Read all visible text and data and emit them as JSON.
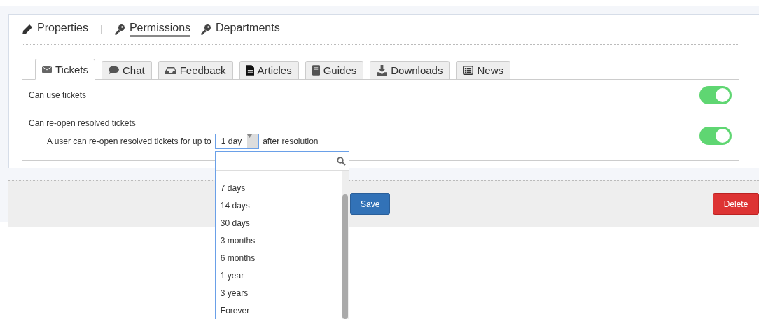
{
  "nav": [
    {
      "kind": "pencil",
      "label": "Properties",
      "selected": false
    },
    {
      "kind": "key",
      "label": "Permissions",
      "selected": true
    },
    {
      "kind": "key",
      "label": "Departments",
      "selected": false
    }
  ],
  "tabs": [
    {
      "kind": "envelope",
      "label": "Tickets",
      "selected": true
    },
    {
      "kind": "chat",
      "label": "Chat",
      "selected": false
    },
    {
      "kind": "inbox",
      "label": "Feedback",
      "selected": false
    },
    {
      "kind": "file",
      "label": "Articles",
      "selected": false
    },
    {
      "kind": "book",
      "label": "Guides",
      "selected": false
    },
    {
      "kind": "download",
      "label": "Downloads",
      "selected": false
    },
    {
      "kind": "list",
      "label": "News",
      "selected": false
    }
  ],
  "settings": [
    {
      "label": "Can use tickets",
      "on": true
    },
    {
      "label": "Can re-open resolved tickets",
      "on": true,
      "detail": {
        "before": "A user can re-open resolved tickets for up to",
        "value": "1 day",
        "after": "after resolution",
        "dropdown": {
          "expanded": true,
          "options": [
            "7 days",
            "14 days",
            "30 days",
            "3 months",
            "6 months",
            "1 year",
            "3 years",
            "Forever"
          ]
        }
      }
    }
  ],
  "buttons": [
    {
      "kind": "primary",
      "label": "Save"
    },
    {
      "kind": "danger",
      "label": "Delete"
    }
  ]
}
